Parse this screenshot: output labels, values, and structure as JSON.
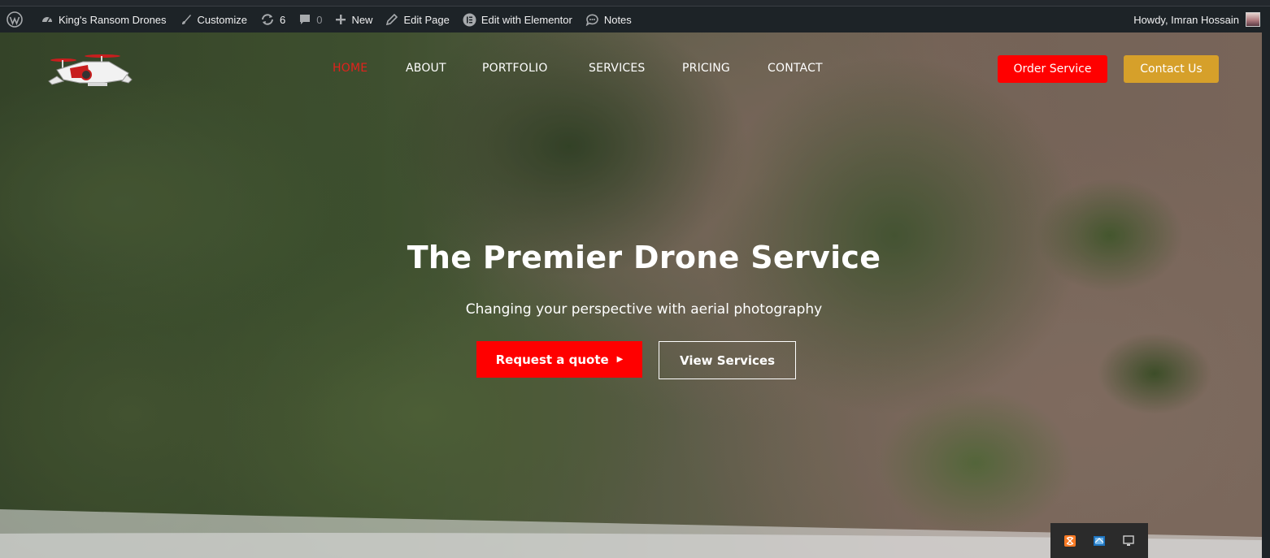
{
  "admin_bar": {
    "site_name": "King's Ransom Drones",
    "customize": "Customize",
    "updates_count": "6",
    "comments_count": "0",
    "new": "New",
    "edit_page": "Edit Page",
    "edit_elementor": "Edit with Elementor",
    "notes": "Notes",
    "howdy": "Howdy, Imran Hossain"
  },
  "nav": {
    "items": [
      {
        "label": "HOME",
        "active": true
      },
      {
        "label": "ABOUT",
        "active": false
      },
      {
        "label": "PORTFOLIO",
        "active": false
      },
      {
        "label": "SERVICES",
        "active": false
      },
      {
        "label": "PRICING",
        "active": false
      },
      {
        "label": "CONTACT",
        "active": false
      }
    ],
    "order_button": "Order Service",
    "contact_button": "Contact Us"
  },
  "hero": {
    "title": "The Premier Drone Service",
    "subtitle": "Changing your perspective with aerial photography",
    "primary_button": "Request a quote",
    "secondary_button": "View Services"
  },
  "colors": {
    "admin_bar_bg": "#1d2327",
    "accent_red": "#ff0000",
    "nav_active": "#e2211c",
    "contact_gold": "#d6a02a"
  },
  "tray": {
    "icons": [
      "xampp-icon",
      "network-icon",
      "display-icon"
    ]
  }
}
